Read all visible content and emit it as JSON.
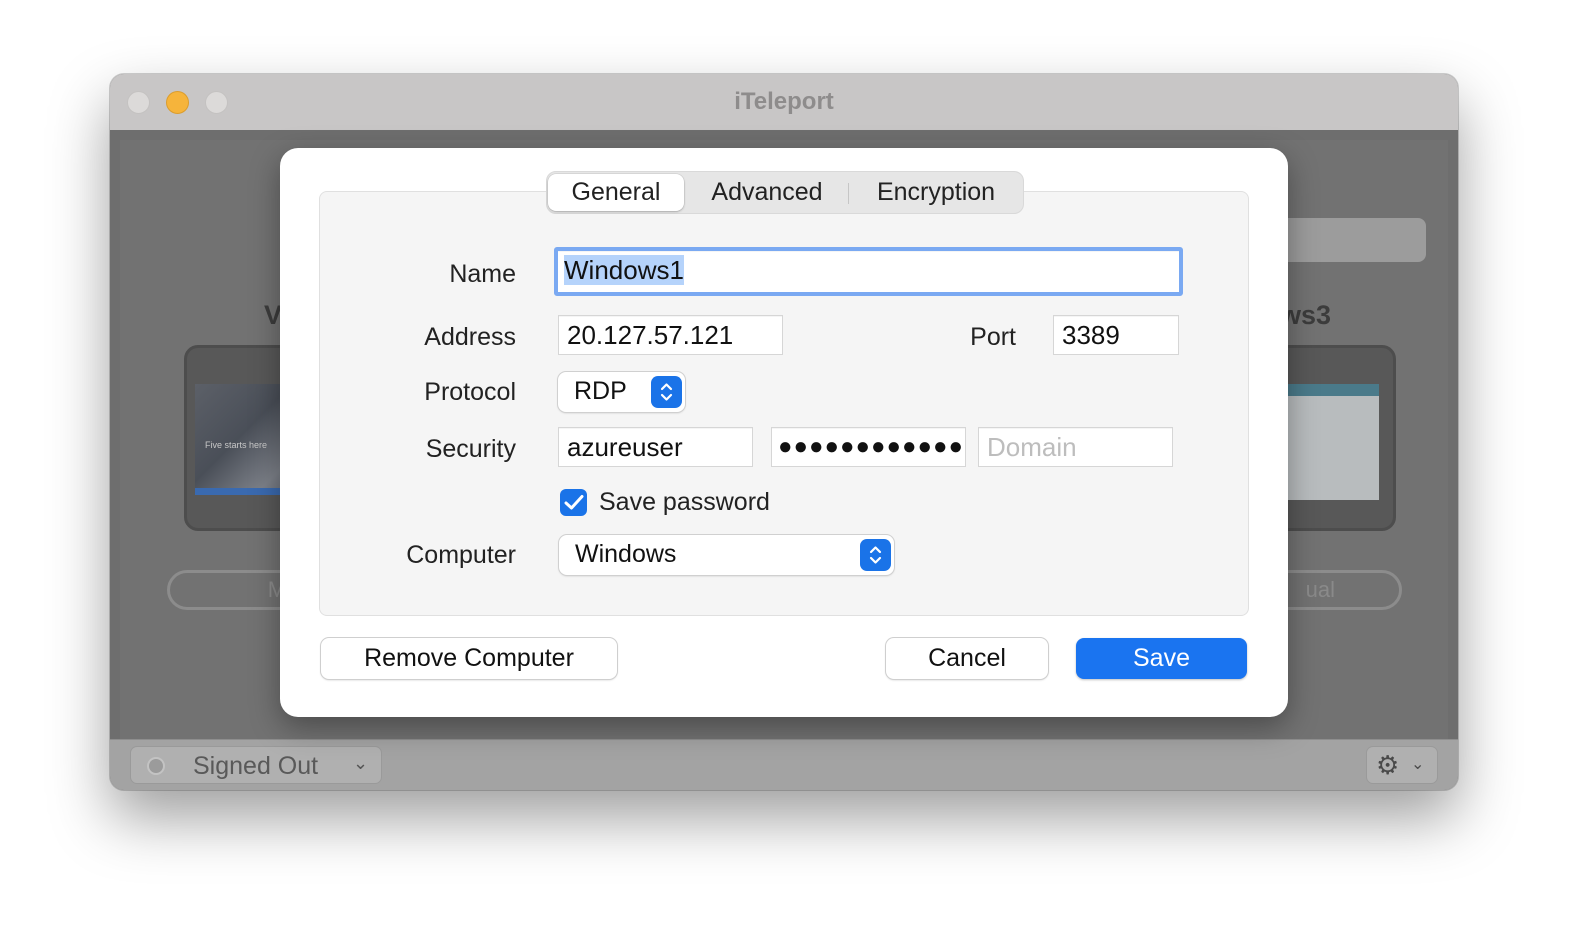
{
  "window": {
    "title": "iTeleport"
  },
  "background": {
    "computers": [
      {
        "name_fragment": "V",
        "button_fragment": "Ma"
      },
      {
        "name_fragment": "ws3",
        "button_fragment": "ual"
      }
    ],
    "thumbnail_text": "Five starts here",
    "status_label": "Signed Out"
  },
  "dialog": {
    "tabs": [
      {
        "label": "General",
        "selected": true
      },
      {
        "label": "Advanced",
        "selected": false
      },
      {
        "label": "Encryption",
        "selected": false
      }
    ],
    "name_label": "Name",
    "name_value": "Windows1",
    "address_label": "Address",
    "address_value": "20.127.57.121",
    "port_label": "Port",
    "port_value": "3389",
    "protocol_label": "Protocol",
    "protocol_value": "RDP",
    "security_label": "Security",
    "username_value": "azureuser",
    "password_mask": "●●●●●●●●●●●●●",
    "domain_placeholder": "Domain",
    "save_password_label": "Save password",
    "save_password_checked": true,
    "computer_label": "Computer",
    "computer_value": "Windows",
    "remove_button": "Remove Computer",
    "cancel_button": "Cancel",
    "save_button": "Save"
  },
  "colors": {
    "accent": "#1a73e8",
    "focus_ring": "#7aa9f2",
    "selection": "#b5d3fb"
  }
}
